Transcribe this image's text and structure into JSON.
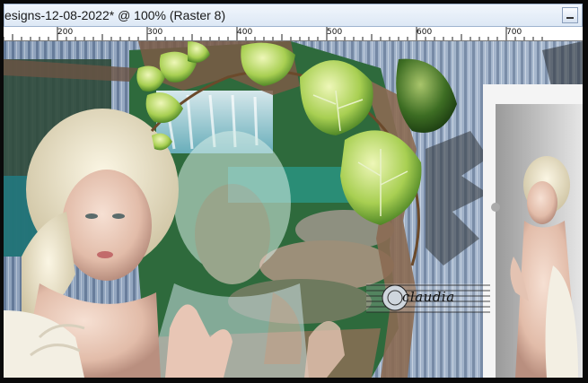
{
  "window": {
    "title": "esigns-12-08-2022* @ 100% (Raster 8)"
  },
  "ruler": {
    "labels": [
      "200",
      "300",
      "400",
      "500",
      "600",
      "700"
    ]
  },
  "watermark": {
    "text": "claudia"
  },
  "colors": {
    "titlebar": "#e6eef8",
    "ruler": "#ffffff",
    "canvas_bg": "#8aa1bd"
  },
  "icons": {
    "minimize": "minimize-icon"
  }
}
